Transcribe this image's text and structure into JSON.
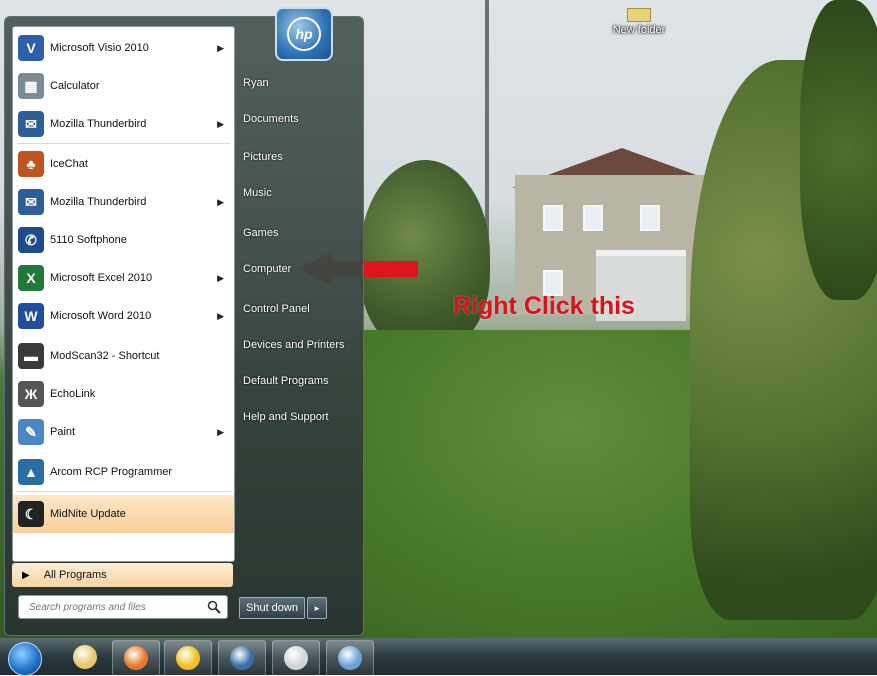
{
  "desktop": {
    "icon_label": "New folder"
  },
  "start_menu": {
    "programs": [
      {
        "label": "Microsoft Visio 2010",
        "icon": "visio-icon",
        "glyph": "V",
        "color": "#2f5fa8",
        "has_arrow": true
      },
      {
        "label": "Calculator",
        "icon": "calculator-icon",
        "glyph": "▦",
        "color": "#7a8a99",
        "has_arrow": false
      },
      {
        "label": "Mozilla Thunderbird",
        "icon": "thunderbird-icon",
        "glyph": "✉",
        "color": "#2d5e9a",
        "has_arrow": true
      },
      {
        "label": "IceChat",
        "icon": "icechat-icon",
        "glyph": "♣",
        "color": "#c0541f",
        "has_arrow": false
      },
      {
        "label": "Mozilla Thunderbird",
        "icon": "thunderbird-icon",
        "glyph": "✉",
        "color": "#2d5e9a",
        "has_arrow": true
      },
      {
        "label": "5110 Softphone",
        "icon": "softphone-icon",
        "glyph": "✆",
        "color": "#1e4b8a",
        "has_arrow": false
      },
      {
        "label": "Microsoft Excel 2010",
        "icon": "excel-icon",
        "glyph": "X",
        "color": "#1f7a3a",
        "has_arrow": true
      },
      {
        "label": "Microsoft Word 2010",
        "icon": "word-icon",
        "glyph": "W",
        "color": "#1f4e9c",
        "has_arrow": true
      },
      {
        "label": "ModScan32 - Shortcut",
        "icon": "modscan-icon",
        "glyph": "▬",
        "color": "#3a3a3a",
        "has_arrow": false
      },
      {
        "label": "EchoLink",
        "icon": "echolink-icon",
        "glyph": "Ж",
        "color": "#555555",
        "has_arrow": false
      },
      {
        "label": "Paint",
        "icon": "paint-icon",
        "glyph": "✎",
        "color": "#4a87c4",
        "has_arrow": true
      },
      {
        "label": "Arcom RCP Programmer",
        "icon": "arcom-icon",
        "glyph": "▲",
        "color": "#2a6fa3",
        "has_arrow": false
      },
      {
        "label": "MidNite Update",
        "icon": "midnite-icon",
        "glyph": "☾",
        "color": "#222222",
        "has_arrow": false
      }
    ],
    "all_programs": "All Programs",
    "search_placeholder": "Search programs and files",
    "right_items": [
      {
        "label": "Ryan",
        "name": "user-folder-link"
      },
      {
        "label": "Documents",
        "name": "documents-link"
      },
      {
        "label": "Pictures",
        "name": "pictures-link"
      },
      {
        "label": "Music",
        "name": "music-link"
      },
      {
        "label": "Games",
        "name": "games-link"
      },
      {
        "label": "Computer",
        "name": "computer-link"
      },
      {
        "label": "Control Panel",
        "name": "control-panel-link"
      },
      {
        "label": "Devices and Printers",
        "name": "devices-printers-link"
      },
      {
        "label": "Default Programs",
        "name": "default-programs-link"
      },
      {
        "label": "Help and Support",
        "name": "help-support-link"
      }
    ],
    "shutdown_label": "Shut down",
    "shutdown_arrow": "▸"
  },
  "annotation": {
    "text": "Right Click this",
    "color": "#e0141b"
  },
  "taskbar": {
    "items": [
      {
        "icon": "explorer-folder-icon",
        "color": "#e7c76a"
      },
      {
        "icon": "firefox-icon",
        "color": "#e8762b"
      },
      {
        "icon": "aim-icon",
        "color": "#f2c01f"
      },
      {
        "icon": "thunderbird-icon",
        "color": "#3a6ea8"
      },
      {
        "icon": "midnite-icon",
        "color": "#cfd6da"
      },
      {
        "icon": "paint-icon",
        "color": "#6aa3d6"
      }
    ]
  }
}
